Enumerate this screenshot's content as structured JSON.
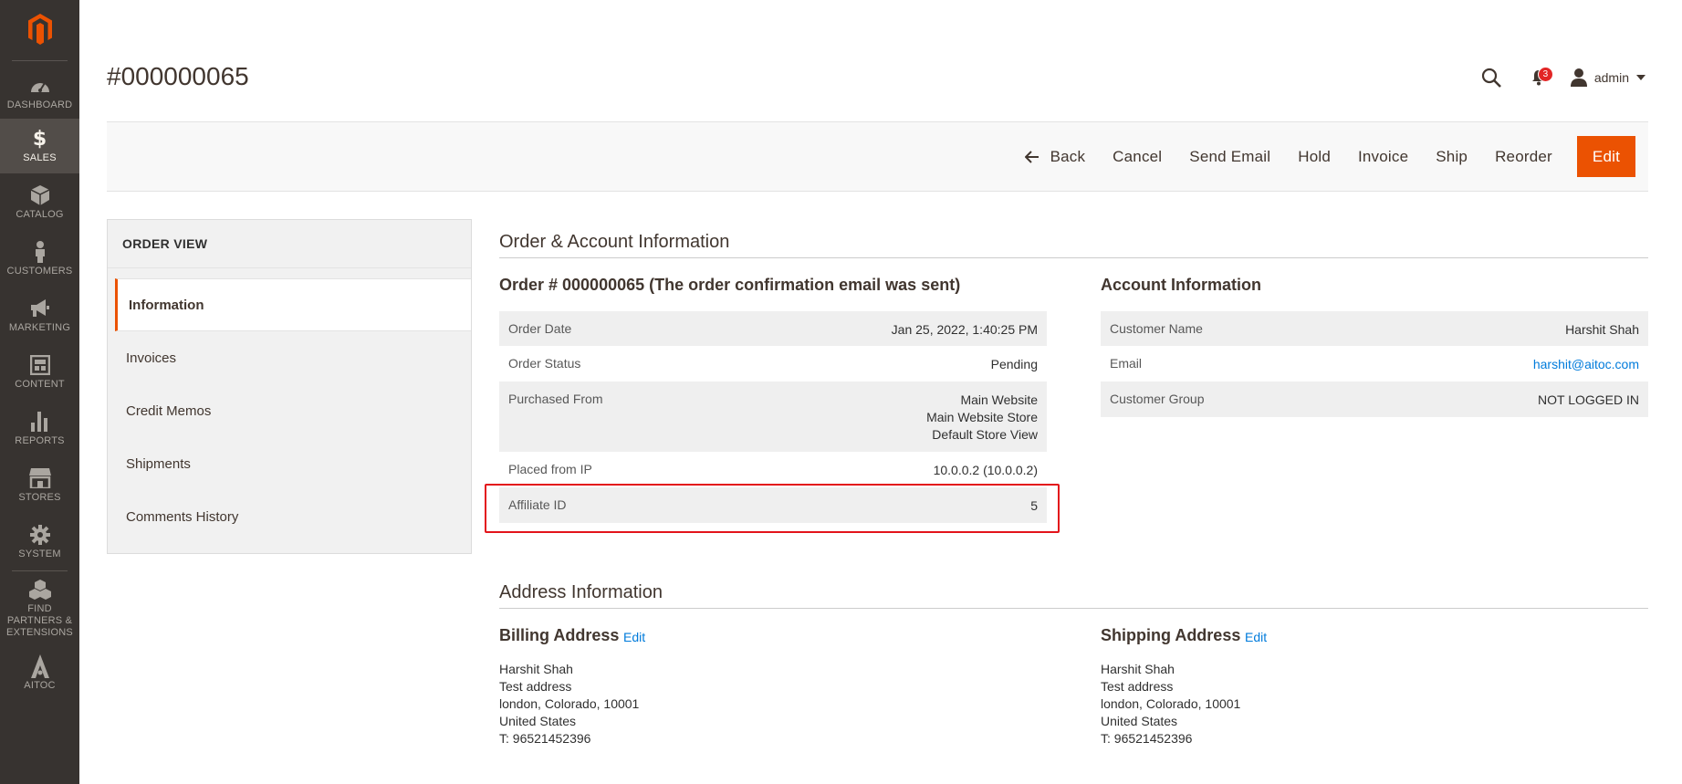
{
  "app": {
    "brand_color": "#eb5202",
    "page_title": "#000000065"
  },
  "sidebar": {
    "items": [
      {
        "label": "DASHBOARD",
        "icon": "dashboard-icon"
      },
      {
        "label": "SALES",
        "icon": "dollar-icon",
        "active": true
      },
      {
        "label": "CATALOG",
        "icon": "box-icon"
      },
      {
        "label": "CUSTOMERS",
        "icon": "person-icon"
      },
      {
        "label": "MARKETING",
        "icon": "megaphone-icon"
      },
      {
        "label": "CONTENT",
        "icon": "layout-icon"
      },
      {
        "label": "REPORTS",
        "icon": "bar-chart-icon"
      },
      {
        "label": "STORES",
        "icon": "store-icon"
      },
      {
        "label": "SYSTEM",
        "icon": "gear-icon"
      },
      {
        "label": "FIND PARTNERS & EXTENSIONS",
        "icon": "cubes-icon"
      },
      {
        "label": "AITOC",
        "icon": "aitoc-icon"
      }
    ]
  },
  "header": {
    "notifications_count": "3",
    "user_name": "admin"
  },
  "toolbar": {
    "back": "Back",
    "cancel": "Cancel",
    "send_email": "Send Email",
    "hold": "Hold",
    "invoice": "Invoice",
    "ship": "Ship",
    "reorder": "Reorder",
    "edit": "Edit"
  },
  "order_view": {
    "title": "ORDER VIEW",
    "tabs": [
      {
        "label": "Information",
        "active": true
      },
      {
        "label": "Invoices"
      },
      {
        "label": "Credit Memos"
      },
      {
        "label": "Shipments"
      },
      {
        "label": "Comments History"
      }
    ]
  },
  "order_account": {
    "section_title": "Order & Account Information",
    "order_heading": "Order # 000000065 (The order confirmation email was sent)",
    "order_rows": [
      {
        "label": "Order Date",
        "value": "Jan 25, 2022, 1:40:25 PM"
      },
      {
        "label": "Order Status",
        "value": "Pending"
      },
      {
        "label": "Purchased From",
        "value_lines": [
          "Main Website",
          "Main Website Store",
          "Default Store View"
        ]
      },
      {
        "label": "Placed from IP",
        "value": "10.0.0.2 (10.0.0.2)"
      },
      {
        "label": "Affiliate ID",
        "value": "5"
      }
    ],
    "account_heading": "Account Information",
    "account_rows": [
      {
        "label": "Customer Name",
        "value": "Harshit Shah"
      },
      {
        "label": "Email",
        "value": "harshit@aitoc.com"
      },
      {
        "label": "Customer Group",
        "value": "NOT LOGGED IN"
      }
    ]
  },
  "address": {
    "section_title": "Address Information",
    "billing": {
      "title": "Billing Address",
      "edit": "Edit",
      "lines": [
        "Harshit Shah",
        "Test address",
        "london, Colorado, 10001",
        "United States",
        "T: 96521452396"
      ]
    },
    "shipping": {
      "title": "Shipping Address",
      "edit": "Edit",
      "lines": [
        "Harshit Shah",
        "Test address",
        "london, Colorado, 10001",
        "United States",
        "T: 96521452396"
      ]
    }
  }
}
